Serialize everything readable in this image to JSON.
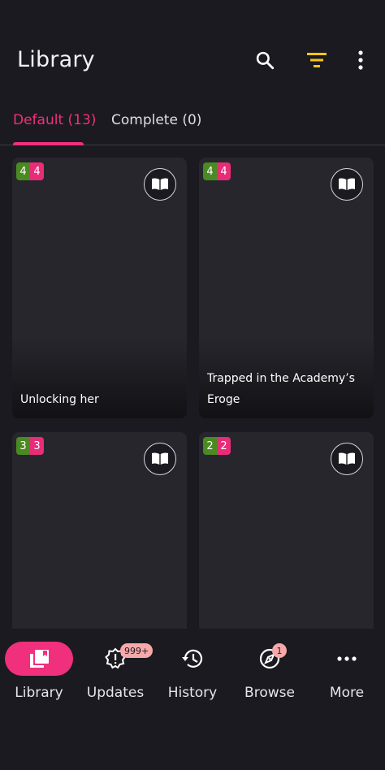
{
  "app": {
    "title": "Library"
  },
  "toolbar": {
    "search_icon": "search-icon",
    "filter_icon": "filter-icon",
    "filter_color": "#f5c518",
    "more_icon": "more-vertical-icon"
  },
  "tabs": [
    {
      "label": "Default (13)",
      "active": true
    },
    {
      "label": "Complete (0)",
      "active": false
    }
  ],
  "accent_color": "#f0307c",
  "cards": [
    {
      "title": "Unlocking her",
      "unread": "4",
      "downloaded": "4"
    },
    {
      "title": "Trapped in the Academy’s Eroge",
      "unread": "4",
      "downloaded": "4"
    },
    {
      "title": "",
      "unread": "3",
      "downloaded": "3"
    },
    {
      "title": "",
      "unread": "2",
      "downloaded": "2"
    }
  ],
  "bottom_nav": [
    {
      "label": "Library",
      "icon": "library-icon",
      "active": true
    },
    {
      "label": "Updates",
      "icon": "updates-icon",
      "badge": "999+"
    },
    {
      "label": "History",
      "icon": "history-icon"
    },
    {
      "label": "Browse",
      "icon": "compass-icon",
      "badge": "1"
    },
    {
      "label": "More",
      "icon": "more-horizontal-icon"
    }
  ]
}
